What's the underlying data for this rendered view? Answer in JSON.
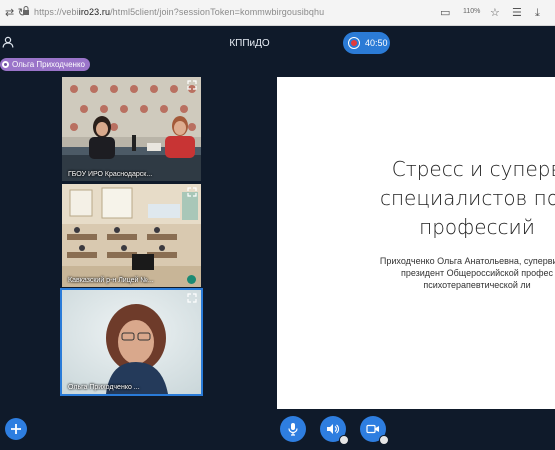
{
  "browser": {
    "url_prefix": "https://vebi",
    "url_domain": "iro23.ru",
    "url_path": "/html5client/join?sessionToken=kommwbirgousibqhu",
    "zoom": "110%"
  },
  "meeting": {
    "title": "КППиДО",
    "timer": "40:50",
    "presenter_name": "Ольга Приходченко"
  },
  "participants": [
    {
      "label": "ГБОУ ИРО Краснодарск..."
    },
    {
      "label": "Кавказский р-н Лицей №..."
    },
    {
      "label": "Ольга Приходченко ..."
    }
  ],
  "slide": {
    "title_line1": "Стресс и суперв",
    "title_line2": "специалистов пом",
    "title_line3": "профессий",
    "subtitle_line1": "Приходченко Ольга Анатольевна, супервизор,",
    "subtitle_line2": "президент Общероссийской профес",
    "subtitle_line3": "психотерапевтической ли"
  },
  "colors": {
    "background": "#0f1a2a",
    "accent": "#2e7ee0",
    "presenter_tag": "#9a74c9",
    "record_dot": "#e23b3b"
  },
  "icons": [
    "user-icon",
    "record-icon",
    "expand-icon",
    "plus-icon",
    "microphone-icon",
    "speaker-icon",
    "camera-icon"
  ]
}
